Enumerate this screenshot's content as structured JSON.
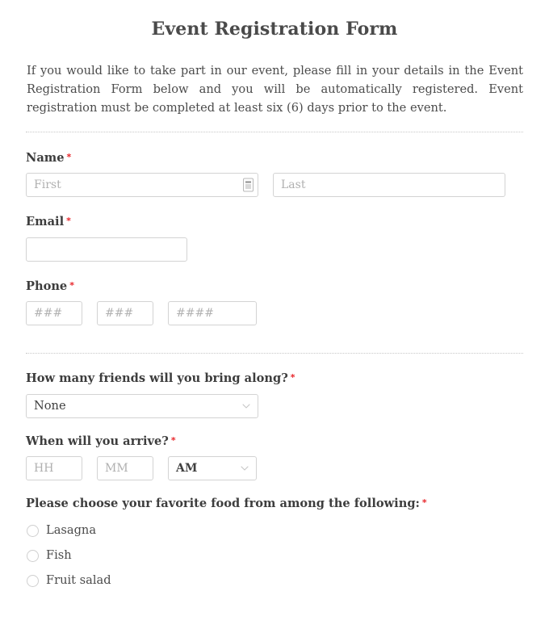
{
  "form": {
    "title": "Event Registration Form",
    "intro": "If you would like to take part in our event, please fill in your details in the Event Registration Form below and you will be automatically registered. Event registration must be completed at least six (6) days prior to the event.",
    "required_marker": "*"
  },
  "name": {
    "label": "Name",
    "first_value": "",
    "first_placeholder": "First",
    "last_value": "",
    "last_placeholder": "Last",
    "autofill_icon": "autofill-card-icon"
  },
  "email": {
    "label": "Email",
    "value": "",
    "placeholder": ""
  },
  "phone": {
    "label": "Phone",
    "area_value": "",
    "area_placeholder": "###",
    "prefix_value": "",
    "prefix_placeholder": "###",
    "line_value": "",
    "line_placeholder": "####"
  },
  "friends": {
    "label": "How many friends will you bring along?",
    "selected": "None",
    "chevron_icon": "chevron-down-icon"
  },
  "arrival": {
    "label": "When will you arrive?",
    "hour_value": "",
    "hour_placeholder": "HH",
    "minute_value": "",
    "minute_placeholder": "MM",
    "meridiem_selected": "AM",
    "chevron_icon": "chevron-down-icon"
  },
  "food": {
    "label": "Please choose your favorite food from among the following:",
    "options": [
      {
        "label": "Lasagna",
        "selected": false
      },
      {
        "label": "Fish",
        "selected": false
      },
      {
        "label": "Fruit salad",
        "selected": false
      }
    ]
  },
  "colors": {
    "required_red": "#e8252a",
    "text": "#4b4b4b",
    "label": "#3d3d3d",
    "border": "#d3d3d3",
    "placeholder": "#b0b0b0",
    "divider": "#c8c8c8",
    "background": "#ffffff"
  }
}
